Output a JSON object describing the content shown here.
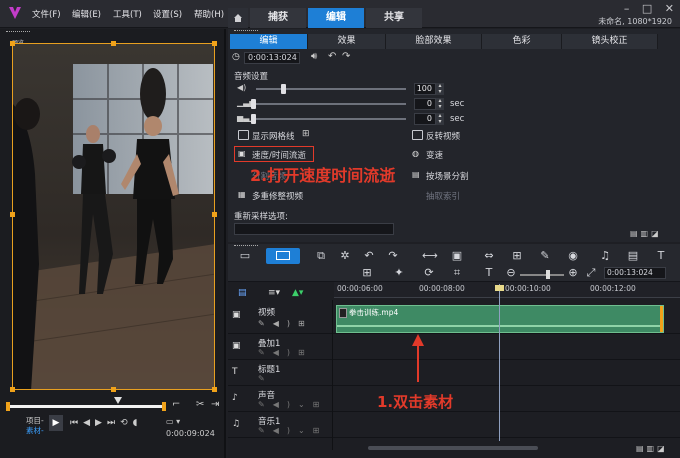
{
  "menu": [
    "文件(F)",
    "编辑(E)",
    "工具(T)",
    "设置(S)",
    "帮助(H)"
  ],
  "mode_tabs": [
    "捕获",
    "编辑",
    "共享"
  ],
  "project_info": "未命名, 1080*1920",
  "options_tabs": [
    "编辑",
    "效果",
    "脸部效果",
    "色彩",
    "镜头校正"
  ],
  "duration": "0:00:13:024",
  "audio": {
    "title": "音频设置",
    "volume": "100",
    "fade_in": "0",
    "fade_out": "0",
    "unit": "sec"
  },
  "options": {
    "show_grid": "显示网格线",
    "reverse": "反转视频",
    "speed_time": "速度/时间流逝",
    "speed_change": "变速",
    "split_scene": "按场景分割",
    "multi_trim": "多重修整视频",
    "resample_label": "重新采样选项:",
    "disabled_1": "分割音频",
    "disabled_2": "抓拍快照",
    "disabled_3": "抽取索引"
  },
  "annotation_speed": "2.打开速度时间流逝",
  "annotation_dblclick": "1.双击素材",
  "preview": {
    "corner_label": "预览",
    "project_label": "项目-",
    "clip_label": "素材-",
    "timecode": "0:00:09:024"
  },
  "timeline": {
    "ruler": [
      "00:00:06:00",
      "00:00:08:00",
      "00:00:10:00",
      "00:00:12:00"
    ],
    "toolbar_time": "0:00:13:024",
    "tracks": [
      "视频",
      "叠加1",
      "标题1",
      "声音",
      "音乐1"
    ],
    "clip_name": "拳击训练.mp4"
  },
  "colors": {
    "accent": "#1e7fd6",
    "annotation": "#e23a2a",
    "clip": "#3e8a64"
  }
}
